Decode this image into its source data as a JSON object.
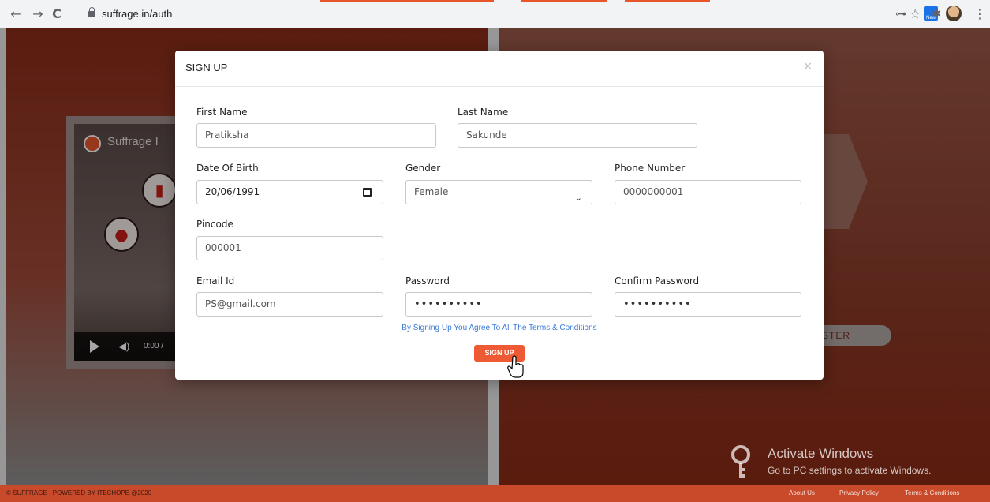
{
  "browser": {
    "url": "suffrage.in/auth",
    "back_icon": "←",
    "forward_icon": "→",
    "reload_icon": "C",
    "key_icon": "⊶",
    "star_icon": "☆",
    "new_badge": "New",
    "extensions_icon": "✱",
    "menu_icon": "⋮"
  },
  "video": {
    "title": "Suffrage I",
    "time": "0:00 /",
    "volume_icon": "◀)"
  },
  "background": {
    "register_label": "STER"
  },
  "modal": {
    "title": "SIGN UP",
    "close": "×",
    "fields": {
      "first_name": {
        "label": "First Name",
        "value": "Pratiksha"
      },
      "last_name": {
        "label": "Last Name",
        "value": "Sakunde"
      },
      "dob": {
        "label": "Date Of Birth",
        "value": "20/06/1991"
      },
      "gender": {
        "label": "Gender",
        "value": "Female"
      },
      "phone": {
        "label": "Phone Number",
        "value": "0000000001"
      },
      "pincode": {
        "label": "Pincode",
        "value": "000001"
      },
      "email": {
        "label": "Email Id",
        "value": "PS@gmail.com"
      },
      "password": {
        "label": "Password",
        "value": "••••••••••"
      },
      "confirm_password": {
        "label": "Confirm Password",
        "value": "••••••••••"
      }
    },
    "terms_text": "By Signing Up You Agree To All The Terms & Conditions",
    "submit_label": "SIGN UP"
  },
  "footer": {
    "copyright": "© SUFFRAGE - POWERED BY ITECHOPE @2020",
    "links": [
      "About Us",
      "Privacy Policy",
      "Terms & Conditions"
    ]
  },
  "watermark": {
    "line1": "Activate Windows",
    "line2": "Go to PC settings to activate Windows."
  },
  "colors": {
    "accent": "#ee5a33",
    "link": "#3a7bd5",
    "footer": "#c84a2a"
  }
}
